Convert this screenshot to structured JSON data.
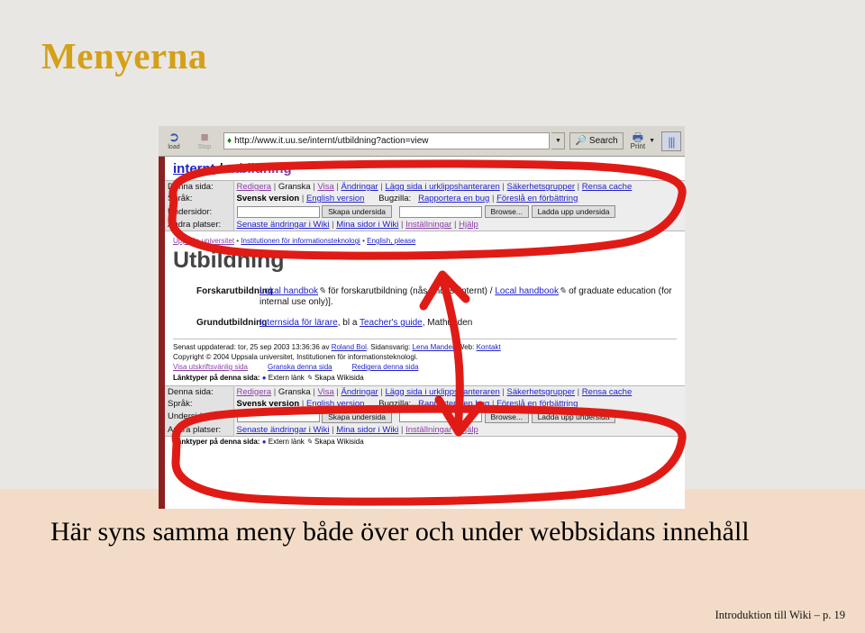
{
  "slide": {
    "title": "Menyerna",
    "caption": "Här syns samma meny både över och under webbsidans innehåll",
    "footer": "Introduktion till Wiki – p. 19",
    "title_color": "#d4a017",
    "bg_upper": "#e9e7e3",
    "bg_lower": "#f3dcc7",
    "annotation_color": "#e01b16"
  },
  "browser": {
    "reload_label": "load",
    "stop_label": "Stop",
    "url": "http://www.it.uu.se/internt/utbildning?action=view",
    "search_label": "Search",
    "print_label": "Print"
  },
  "page": {
    "breadcrumb": {
      "first": "internt",
      "sep": "/",
      "second": "utbildning"
    },
    "org_line": {
      "university": "Uppsala universitet",
      "department": "Institutionen för informationsteknologi",
      "english": "English, please"
    },
    "heading": "Utbildning",
    "rows": [
      {
        "key": "Forskarutbildning",
        "pre": "",
        "link1": "Lokal handbok",
        "mid": " för forskarutbildning (nås endast internt) / ",
        "link2": "Local handbook",
        "post": " of graduate education (for internal use only)]."
      },
      {
        "key": "Grundutbildning",
        "pre": "",
        "link1": "Internsida för lärare",
        "mid": ", bl a ",
        "link2": "Teacher's guide",
        "post": ", Mathunden"
      }
    ],
    "footer": {
      "updated": "Senast uppdaterad: tor, 25 sep 2003 13:36:36 av ",
      "updated_by": "Roland Bol",
      "resp_label": ". Sidansvarig: ",
      "resp_name": "Lena Mandell",
      "web_label": " Web: ",
      "web_link": "Kontakt",
      "copyright": "Copyright © 2004 Uppsala universitet, Institutionen för informationsteknologi.",
      "link_print": "Visa utskriftsvänlig sida",
      "link_review": "Granska denna sida",
      "link_edit": "Redigera denna sida",
      "linktypes_label": "Länktyper på denna sida:",
      "linktype_extern": "Extern länk",
      "linktype_wiki": "Skapa Wikisida"
    }
  },
  "wiki_menu": {
    "rows": [
      {
        "label": "Denna sida:",
        "links": [
          "Redigera",
          "Granska",
          "Visa",
          "Ändringar",
          "Lägg sida i urklippshanteraren",
          "Säkerhetsgrupper",
          "Rensa cache"
        ]
      },
      {
        "label": "Språk:",
        "current": "Svensk version",
        "other": "English version",
        "bugzilla_label": "Bugzilla:",
        "bug_links": [
          "Rapportera en bug",
          "Föreslå en förbättring"
        ]
      },
      {
        "label": "Undersidor:",
        "create_button": "Skapa undersida",
        "browse_button": "Browse...",
        "upload_button": "Ladda upp undersida"
      },
      {
        "label": "Andra platser:",
        "links": [
          "Senaste ändringar i Wiki",
          "Mina sidor i Wiki",
          "Inställningar",
          "Hjälp"
        ]
      }
    ]
  }
}
